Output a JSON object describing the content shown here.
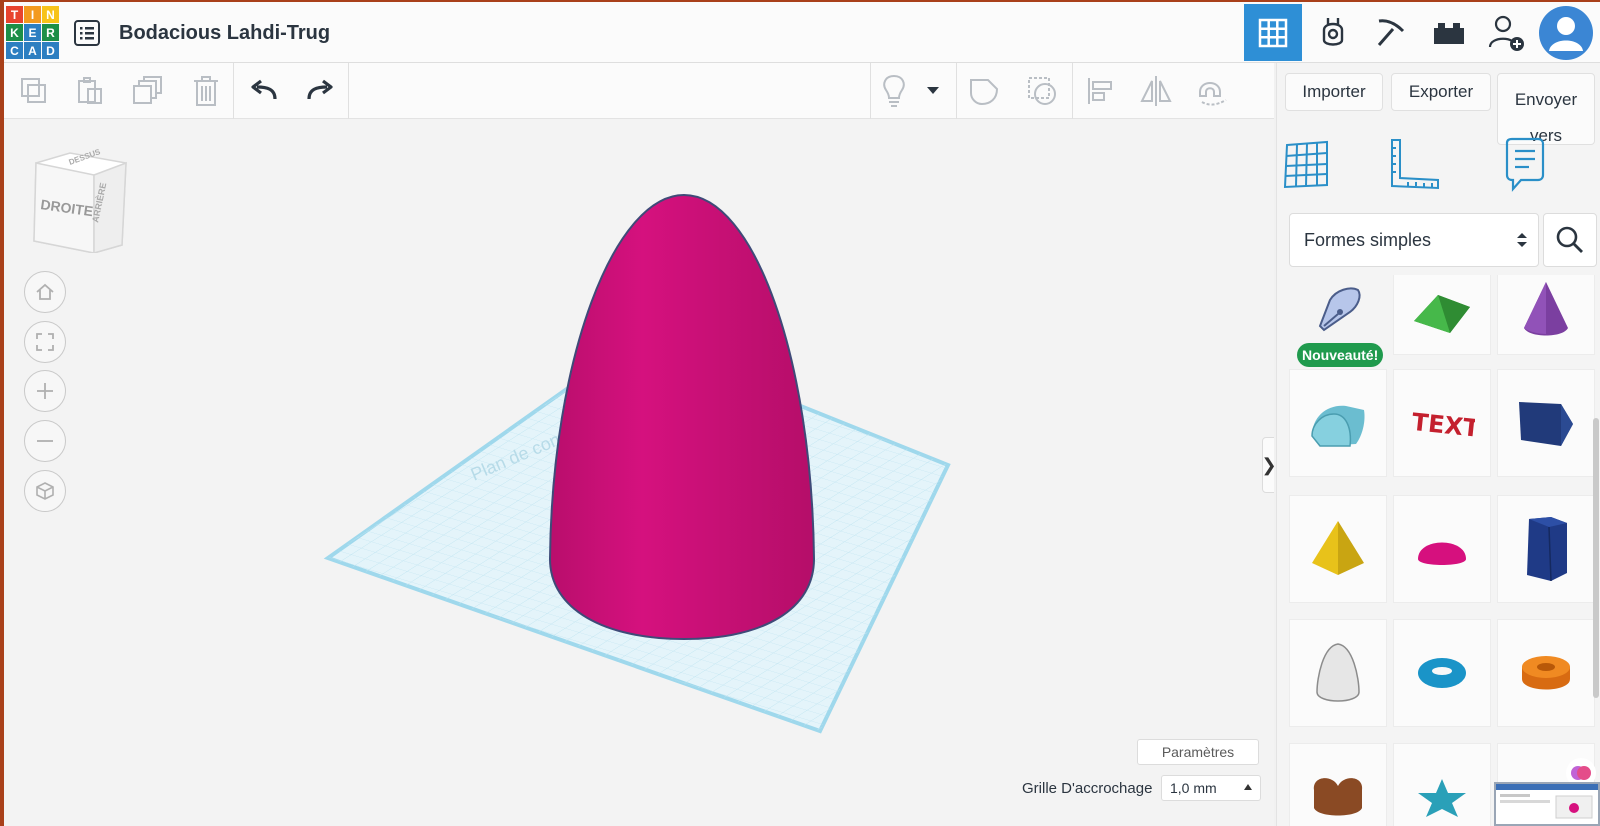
{
  "app": {
    "logo_letters": [
      "T",
      "I",
      "N",
      "K",
      "E",
      "R",
      "C",
      "A",
      "D"
    ],
    "logo_colors": [
      "#e8442e",
      "#f39a1e",
      "#f7c31a",
      "#1d8f48",
      "#2d7fc1",
      "#1d8f48",
      "#2d7fc1",
      "#2d7fc1",
      "#2d7fc1"
    ],
    "design_title": "Bodacious Lahdi-Trug",
    "accent_color": "#2e8fd6"
  },
  "topbar": {
    "icons": [
      "grid-3d-icon",
      "circuits-icon",
      "minecraft-pickaxe-icon",
      "bricks-icon",
      "invite-user-icon",
      "user-avatar"
    ]
  },
  "toolbar": {
    "tools": [
      "copy-icon",
      "paste-icon",
      "duplicate-icon",
      "delete-icon",
      "undo-icon",
      "redo-icon",
      "light-bulb-icon",
      "dropdown-icon",
      "solid-shape-icon",
      "hole-shape-icon",
      "align-icon",
      "mirror-icon",
      "cruise-magnet-icon"
    ]
  },
  "rightpanel": {
    "import_label": "Importer",
    "export_label": "Exporter",
    "send_label": "Envoyer vers",
    "library_selected": "Formes simples",
    "new_badge": "Nouveauté!",
    "shapes": [
      "scribble",
      "roof",
      "cone",
      "half-cylinder",
      "text",
      "polygon",
      "pyramid",
      "half-sphere",
      "hexagonal-prism",
      "paraboloid",
      "torus",
      "tube",
      "heart",
      "star",
      "more"
    ]
  },
  "workplane": {
    "viewcube_face": "DROITE",
    "viewcube_back": "ARRIÈRE",
    "viewcube_top": "DESSUS",
    "plane_label": "Plan de construction",
    "settings_label": "Paramètres",
    "snap_grid_label": "Grille D'accrochage",
    "snap_grid_value": "1,0 mm",
    "object_color": "#d6107e",
    "grid_color": "#9fd8ec"
  }
}
